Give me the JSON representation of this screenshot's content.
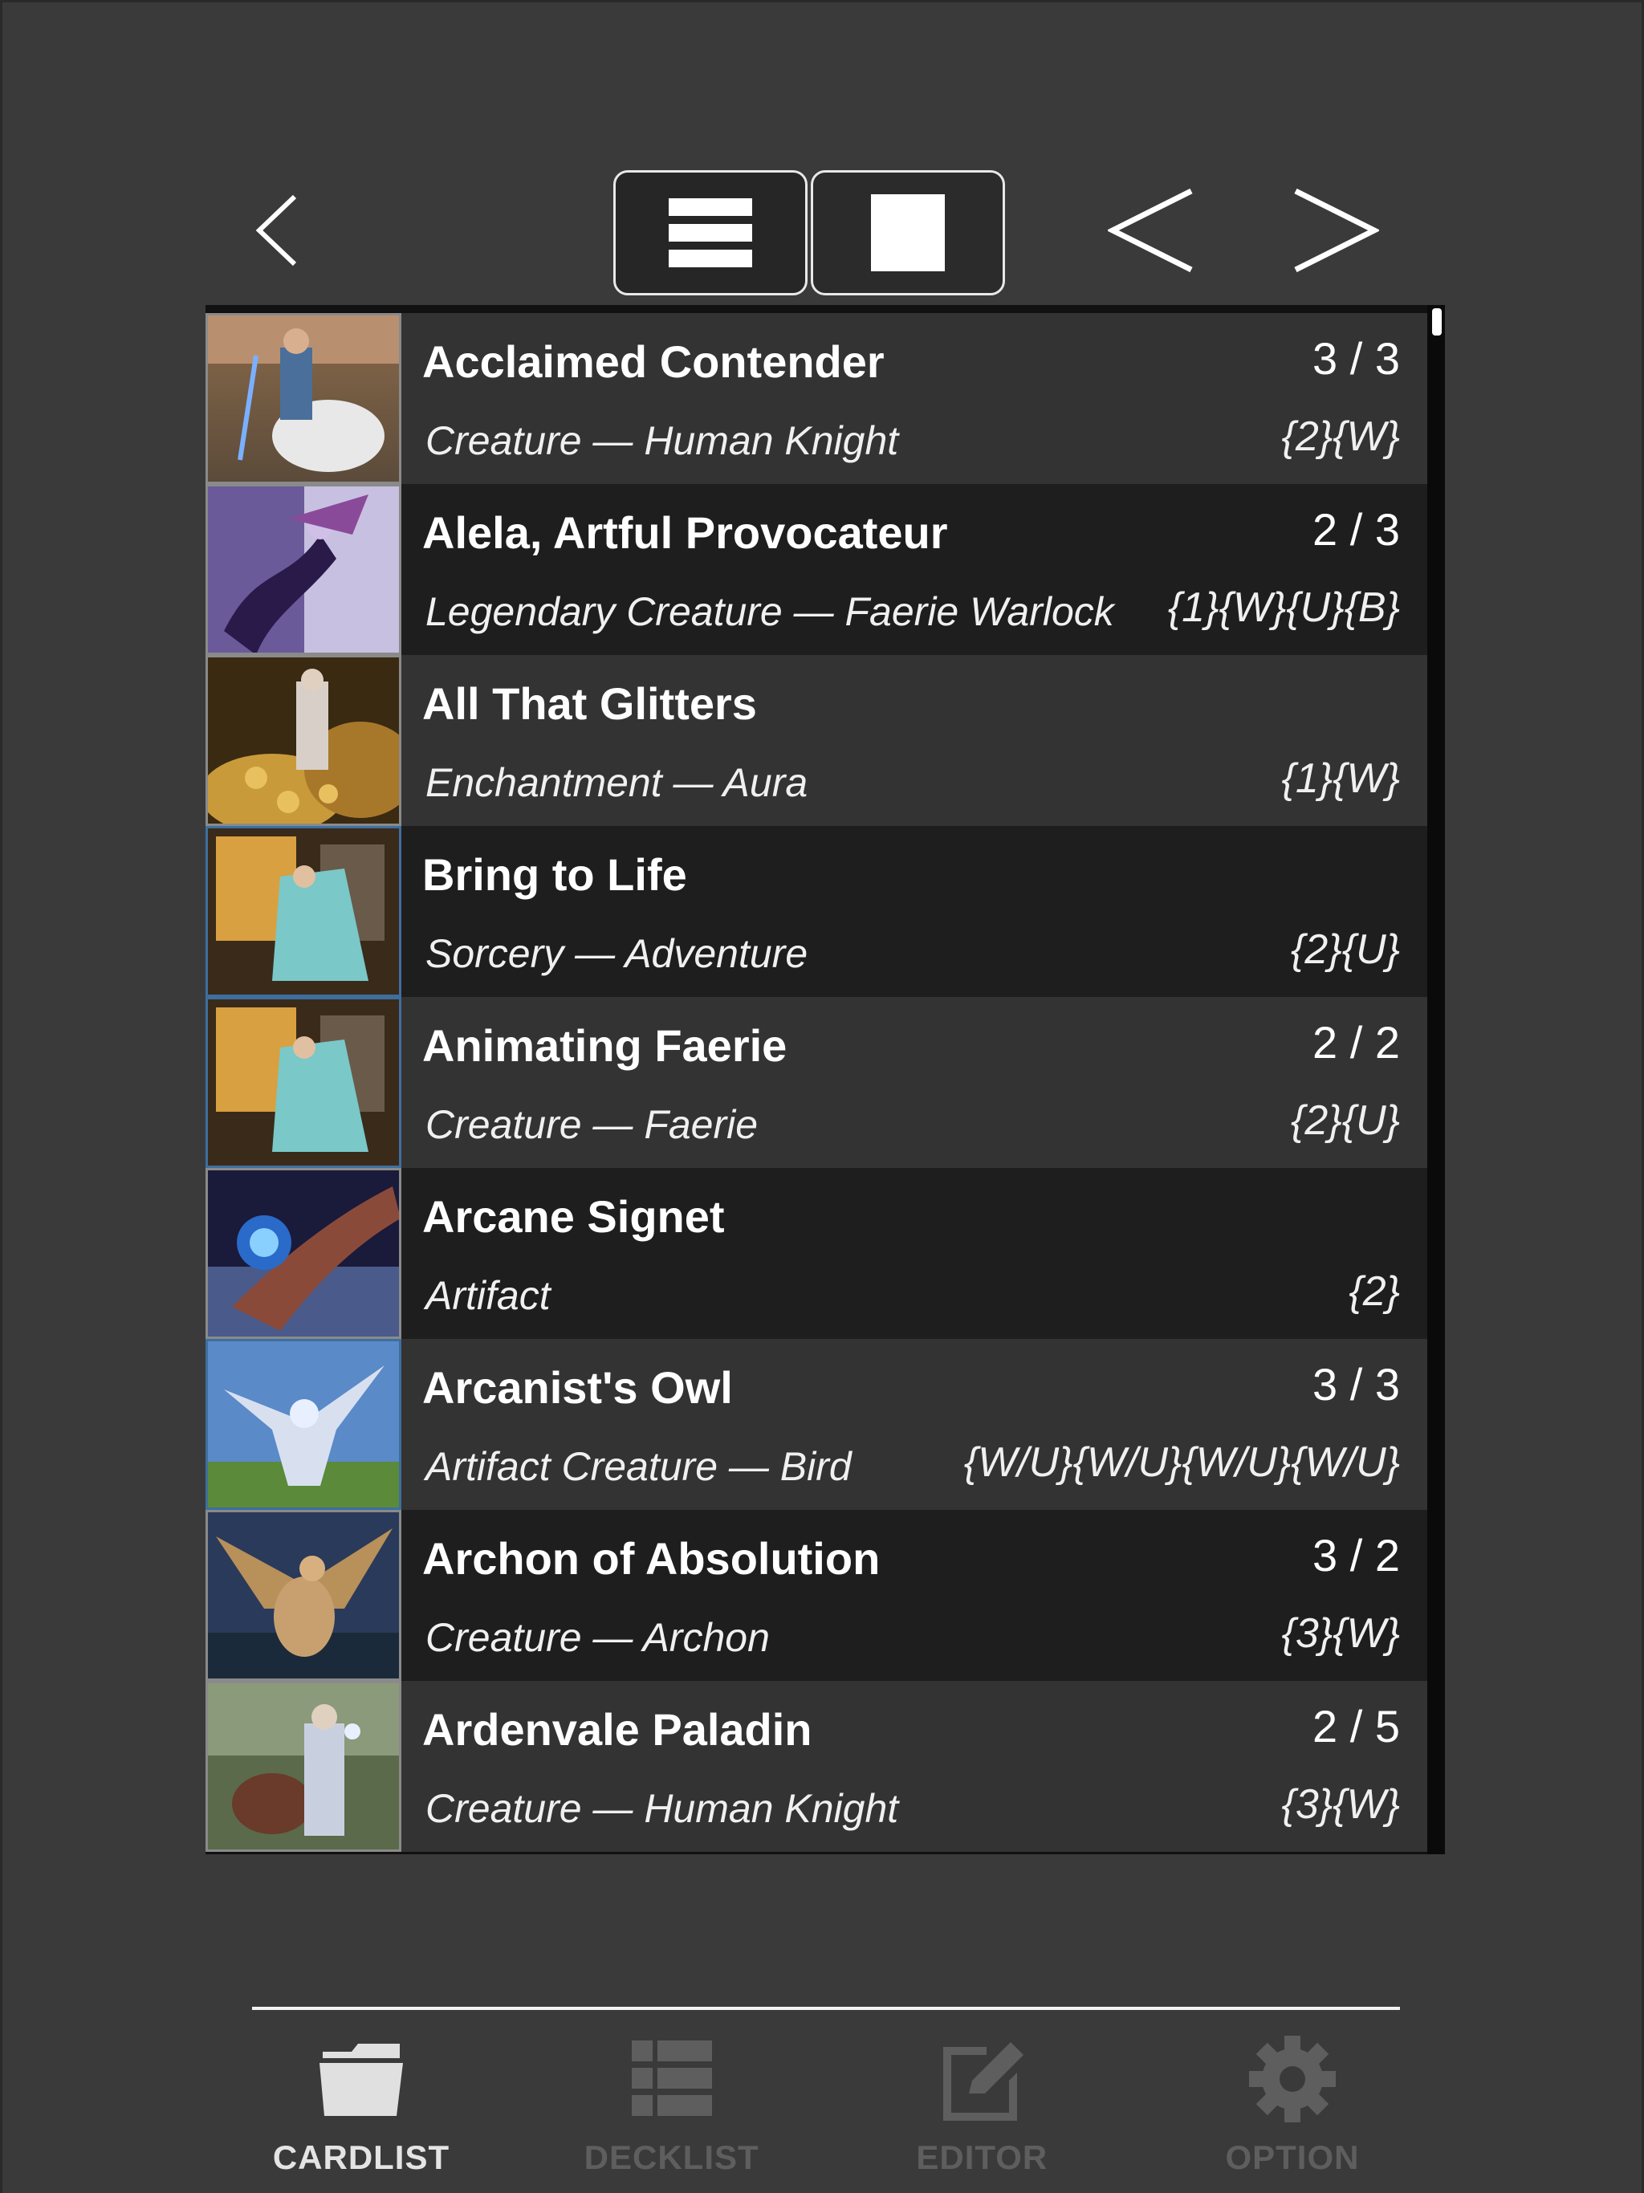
{
  "toolbar": {
    "back_icon": "chevron-left-icon",
    "list_view_icon": "list-view-icon",
    "grid_view_icon": "single-card-view-icon",
    "prev_icon": "arrow-left-icon",
    "next_icon": "arrow-right-icon"
  },
  "cards": [
    {
      "name": "Acclaimed Contender",
      "pt": "3 / 3",
      "type": "Creature — Human Knight",
      "cost": "{2}{W}"
    },
    {
      "name": "Alela, Artful Provocateur",
      "pt": "2 / 3",
      "type": "Legendary Creature — Faerie Warlock",
      "cost": "{1}{W}{U}{B}"
    },
    {
      "name": "All That Glitters",
      "pt": "",
      "type": "Enchantment — Aura",
      "cost": "{1}{W}"
    },
    {
      "name": "Bring to Life",
      "pt": "",
      "type": "Sorcery — Adventure",
      "cost": "{2}{U}"
    },
    {
      "name": "Animating Faerie",
      "pt": "2 / 2",
      "type": "Creature — Faerie",
      "cost": "{2}{U}"
    },
    {
      "name": "Arcane Signet",
      "pt": "",
      "type": "Artifact",
      "cost": "{2}"
    },
    {
      "name": "Arcanist's Owl",
      "pt": "3 / 3",
      "type": "Artifact Creature — Bird",
      "cost": "{W/U}{W/U}{W/U}{W/U}"
    },
    {
      "name": "Archon of Absolution",
      "pt": "3 / 2",
      "type": "Creature — Archon",
      "cost": "{3}{W}"
    },
    {
      "name": "Ardenvale Paladin",
      "pt": "2 / 5",
      "type": "Creature — Human Knight",
      "cost": "{3}{W}"
    }
  ],
  "bottom_nav": {
    "tabs": [
      {
        "label": "CARDLIST",
        "icon": "folder-icon",
        "active": true
      },
      {
        "label": "DECKLIST",
        "icon": "list-icon",
        "active": false
      },
      {
        "label": "EDITOR",
        "icon": "edit-icon",
        "active": false
      },
      {
        "label": "OPTION",
        "icon": "gear-icon",
        "active": false
      }
    ]
  },
  "colors": {
    "background": "#3a3a3a",
    "row_light": "#333333",
    "row_dark": "#1e1e1e",
    "active_tab": "#e4e4e4",
    "inactive_tab": "#5e5e5e"
  }
}
